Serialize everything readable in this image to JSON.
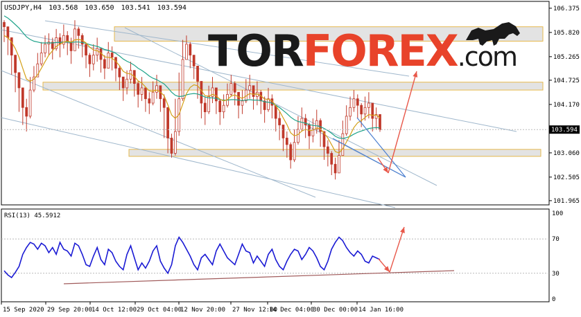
{
  "header": {
    "symbol": "USDJPY,H4",
    "open": "103.568",
    "high": "103.650",
    "low": "103.541",
    "close": "103.594"
  },
  "logo": {
    "part1": "TOR",
    "part2": "FOREX",
    "part3": ".com",
    "color_dark": "#1a1a1a",
    "color_accent": "#e8432a"
  },
  "rsi_label": "RSI(13) 45.5912",
  "current_price_label": "103.594",
  "colors": {
    "candle": "#c0392b",
    "ma_fast": "#d4a017",
    "ma_slow": "#1fa38a",
    "rsi_line": "#1a1ad4",
    "channel": "#9fb7cc",
    "zone_fill": "#d9d9d9",
    "zone_border": "#e6b84d",
    "arrow": "#e8584a",
    "rsi_support": "#a05a5a",
    "grid": "#b8b8b8"
  },
  "chart_data": [
    {
      "type": "candlestick",
      "series": [
        {
          "name": "USDJPY,H4",
          "close": [
            105.95,
            105.7,
            105.3,
            104.9,
            104.55,
            104.1,
            103.9,
            104.5,
            104.8,
            105.1,
            105.35,
            105.55,
            105.6,
            105.45,
            105.7,
            105.55,
            105.75,
            105.6,
            105.4,
            105.9,
            105.75,
            105.55,
            105.3,
            105.1,
            105.3,
            105.45,
            105.2,
            105.0,
            105.35,
            105.25,
            105.0,
            104.8,
            104.55,
            104.75,
            104.95,
            104.65,
            104.4,
            104.55,
            104.3,
            104.2,
            104.45,
            104.6,
            104.3,
            104.1,
            103.4,
            103.05,
            103.55,
            104.3,
            105.2,
            105.55,
            105.3,
            105.05,
            104.7,
            104.2,
            104.0,
            104.35,
            104.55,
            104.25,
            104.0,
            104.15,
            104.4,
            104.65,
            104.45,
            104.15,
            104.25,
            104.5,
            104.6,
            104.35,
            104.45,
            104.25,
            104.05,
            104.3,
            104.15,
            103.85,
            103.7,
            103.4,
            103.25,
            102.9,
            103.3,
            103.6,
            103.85,
            103.7,
            103.45,
            103.6,
            103.8,
            103.55,
            103.2,
            103.05,
            102.8,
            102.6,
            103.0,
            103.5,
            103.9,
            104.1,
            104.3,
            104.15,
            103.95,
            104.1,
            104.2,
            103.85,
            103.94,
            103.594
          ],
          "high": [
            106.1,
            105.9,
            105.55,
            105.1,
            104.75,
            104.35,
            104.3,
            104.8,
            105.05,
            105.35,
            105.6,
            105.75,
            105.8,
            105.7,
            105.9,
            105.8,
            106.0,
            105.85,
            105.7,
            106.1,
            105.95,
            105.8,
            105.55,
            105.35,
            105.55,
            105.7,
            105.45,
            105.3,
            105.6,
            105.5,
            105.25,
            105.05,
            104.8,
            104.95,
            105.15,
            104.9,
            104.7,
            104.8,
            104.55,
            104.45,
            104.7,
            104.85,
            104.6,
            104.4,
            103.8,
            103.5,
            104.3,
            104.9,
            105.65,
            105.75,
            105.6,
            105.3,
            105.0,
            104.55,
            104.35,
            104.6,
            104.8,
            104.55,
            104.3,
            104.4,
            104.65,
            104.85,
            104.7,
            104.45,
            104.5,
            104.75,
            104.85,
            104.6,
            104.7,
            104.5,
            104.35,
            104.55,
            104.4,
            104.15,
            104.0,
            103.7,
            103.55,
            103.3,
            103.6,
            103.9,
            104.1,
            103.95,
            103.75,
            103.85,
            104.05,
            103.85,
            103.5,
            103.35,
            103.1,
            102.95,
            103.35,
            103.8,
            104.15,
            104.35,
            104.5,
            104.4,
            104.2,
            104.35,
            104.45,
            104.15,
            104.1,
            103.65
          ],
          "low": [
            105.6,
            105.3,
            104.85,
            104.45,
            104.0,
            103.7,
            103.55,
            103.85,
            104.45,
            104.8,
            105.05,
            105.25,
            105.3,
            105.2,
            105.4,
            105.25,
            105.45,
            105.3,
            105.1,
            105.5,
            105.45,
            105.25,
            105.0,
            104.8,
            104.95,
            105.15,
            104.9,
            104.75,
            105.0,
            104.95,
            104.7,
            104.5,
            104.25,
            104.4,
            104.65,
            104.35,
            104.1,
            104.25,
            104.0,
            103.95,
            104.15,
            104.3,
            104.0,
            103.4,
            103.05,
            102.95,
            103.0,
            103.45,
            104.25,
            105.2,
            105.0,
            104.75,
            104.3,
            103.85,
            103.7,
            103.95,
            104.2,
            103.95,
            103.7,
            103.85,
            104.1,
            104.35,
            104.15,
            103.85,
            103.95,
            104.2,
            104.3,
            104.05,
            104.15,
            103.95,
            103.75,
            104.0,
            103.85,
            103.55,
            103.35,
            103.1,
            102.95,
            102.7,
            102.85,
            103.25,
            103.55,
            103.4,
            103.15,
            103.3,
            103.5,
            103.2,
            102.9,
            102.75,
            102.55,
            102.45,
            102.65,
            103.0,
            103.45,
            103.8,
            104.0,
            103.85,
            103.65,
            103.8,
            103.85,
            103.55,
            103.6,
            103.541
          ]
        },
        {
          "name": "MA fast",
          "values": [
            105.75,
            105.7,
            105.6,
            105.45,
            105.25,
            105.0,
            104.75,
            104.7,
            104.75,
            104.85,
            105.0,
            105.15,
            105.3,
            105.4,
            105.5,
            105.55,
            105.6,
            105.62,
            105.6,
            105.65,
            105.66,
            105.64,
            105.58,
            105.48,
            105.42,
            105.4,
            105.35,
            105.26,
            105.25,
            105.23,
            105.16,
            105.06,
            104.93,
            104.88,
            104.87,
            104.81,
            104.71,
            104.66,
            104.57,
            104.48,
            104.47,
            104.5,
            104.45,
            104.37,
            104.16,
            103.93,
            103.85,
            103.94,
            104.18,
            104.42,
            104.56,
            104.62,
            104.6,
            104.49,
            104.37,
            104.36,
            104.4,
            104.37,
            104.29,
            104.25,
            104.28,
            104.36,
            104.39,
            104.34,
            104.31,
            104.36,
            104.42,
            104.4,
            104.41,
            104.37,
            104.29,
            104.29,
            104.25,
            104.14,
            104.02,
            103.86,
            103.71,
            103.52,
            103.45,
            103.48,
            103.56,
            103.6,
            103.57,
            103.58,
            103.63,
            103.61,
            103.51,
            103.4,
            103.25,
            103.09,
            103.06,
            103.15,
            103.31,
            103.47,
            103.64,
            103.75,
            103.8,
            103.87,
            103.94,
            103.92,
            103.93,
            103.86
          ]
        },
        {
          "name": "MA slow",
          "values": [
            106.2,
            106.15,
            106.08,
            106.0,
            105.92,
            105.82,
            105.72,
            105.66,
            105.62,
            105.6,
            105.58,
            105.58,
            105.58,
            105.58,
            105.59,
            105.59,
            105.6,
            105.6,
            105.59,
            105.6,
            105.6,
            105.59,
            105.57,
            105.54,
            105.52,
            105.5,
            105.47,
            105.43,
            105.41,
            105.38,
            105.34,
            105.28,
            105.21,
            105.16,
            105.12,
            105.07,
            105.0,
            104.95,
            104.89,
            104.82,
            104.77,
            104.74,
            104.69,
            104.64,
            104.55,
            104.45,
            104.38,
            104.35,
            104.36,
            104.39,
            104.41,
            104.42,
            104.41,
            104.38,
            104.34,
            104.32,
            104.32,
            104.31,
            104.28,
            104.27,
            104.27,
            104.28,
            104.28,
            104.27,
            104.26,
            104.27,
            104.28,
            104.27,
            104.27,
            104.26,
            104.23,
            104.22,
            104.2,
            104.15,
            104.1,
            104.03,
            103.96,
            103.88,
            103.82,
            103.78,
            103.76,
            103.74,
            103.71,
            103.69,
            103.68,
            103.66,
            103.62,
            103.57,
            103.51,
            103.44,
            103.4,
            103.39,
            103.41,
            103.44,
            103.49,
            103.53,
            103.56,
            103.59,
            103.62,
            103.63,
            103.64,
            103.63
          ]
        }
      ],
      "x_tick_labels": [
        "15 Sep 2020",
        "29 Sep 20:00",
        "14 Oct 12:00",
        "29 Oct 04:00",
        "12 Nov 20:00",
        "27 Nov 12:00",
        "14 Dec 04:00",
        "30 Dec 00:00",
        "14 Jan 16:00"
      ],
      "y_tick_labels": [
        "106.375",
        "105.820",
        "105.265",
        "104.725",
        "104.170",
        "103.060",
        "102.505",
        "101.965"
      ],
      "ylim": [
        101.9,
        106.5
      ],
      "zones": [
        {
          "from": 105.62,
          "to": 105.95
        },
        {
          "from": 104.5,
          "to": 104.68
        },
        {
          "from": 102.98,
          "to": 103.14
        }
      ],
      "current_price": 103.594,
      "legend": "top-left",
      "grid": true
    },
    {
      "type": "line",
      "series": [
        {
          "name": "RSI(13) 45.5912",
          "values": [
            33,
            28,
            25,
            31,
            38,
            52,
            60,
            66,
            64,
            58,
            65,
            62,
            54,
            60,
            52,
            66,
            58,
            56,
            50,
            65,
            62,
            52,
            40,
            38,
            50,
            60,
            46,
            40,
            58,
            54,
            44,
            38,
            34,
            52,
            62,
            48,
            34,
            42,
            36,
            44,
            56,
            62,
            44,
            36,
            30,
            40,
            62,
            72,
            66,
            58,
            50,
            40,
            34,
            48,
            52,
            46,
            40,
            56,
            64,
            56,
            48,
            44,
            40,
            52,
            64,
            56,
            54,
            42,
            50,
            44,
            38,
            52,
            58,
            46,
            38,
            34,
            44,
            52,
            58,
            56,
            46,
            52,
            60,
            56,
            48,
            38,
            34,
            44,
            58,
            66,
            72,
            68,
            60,
            54,
            50,
            56,
            52,
            44,
            42,
            50,
            48,
            46
          ]
        }
      ],
      "y_tick_labels": [
        "100",
        "70",
        "30",
        "0"
      ],
      "ylim": [
        0,
        100
      ],
      "levels": [
        70,
        30
      ]
    }
  ]
}
